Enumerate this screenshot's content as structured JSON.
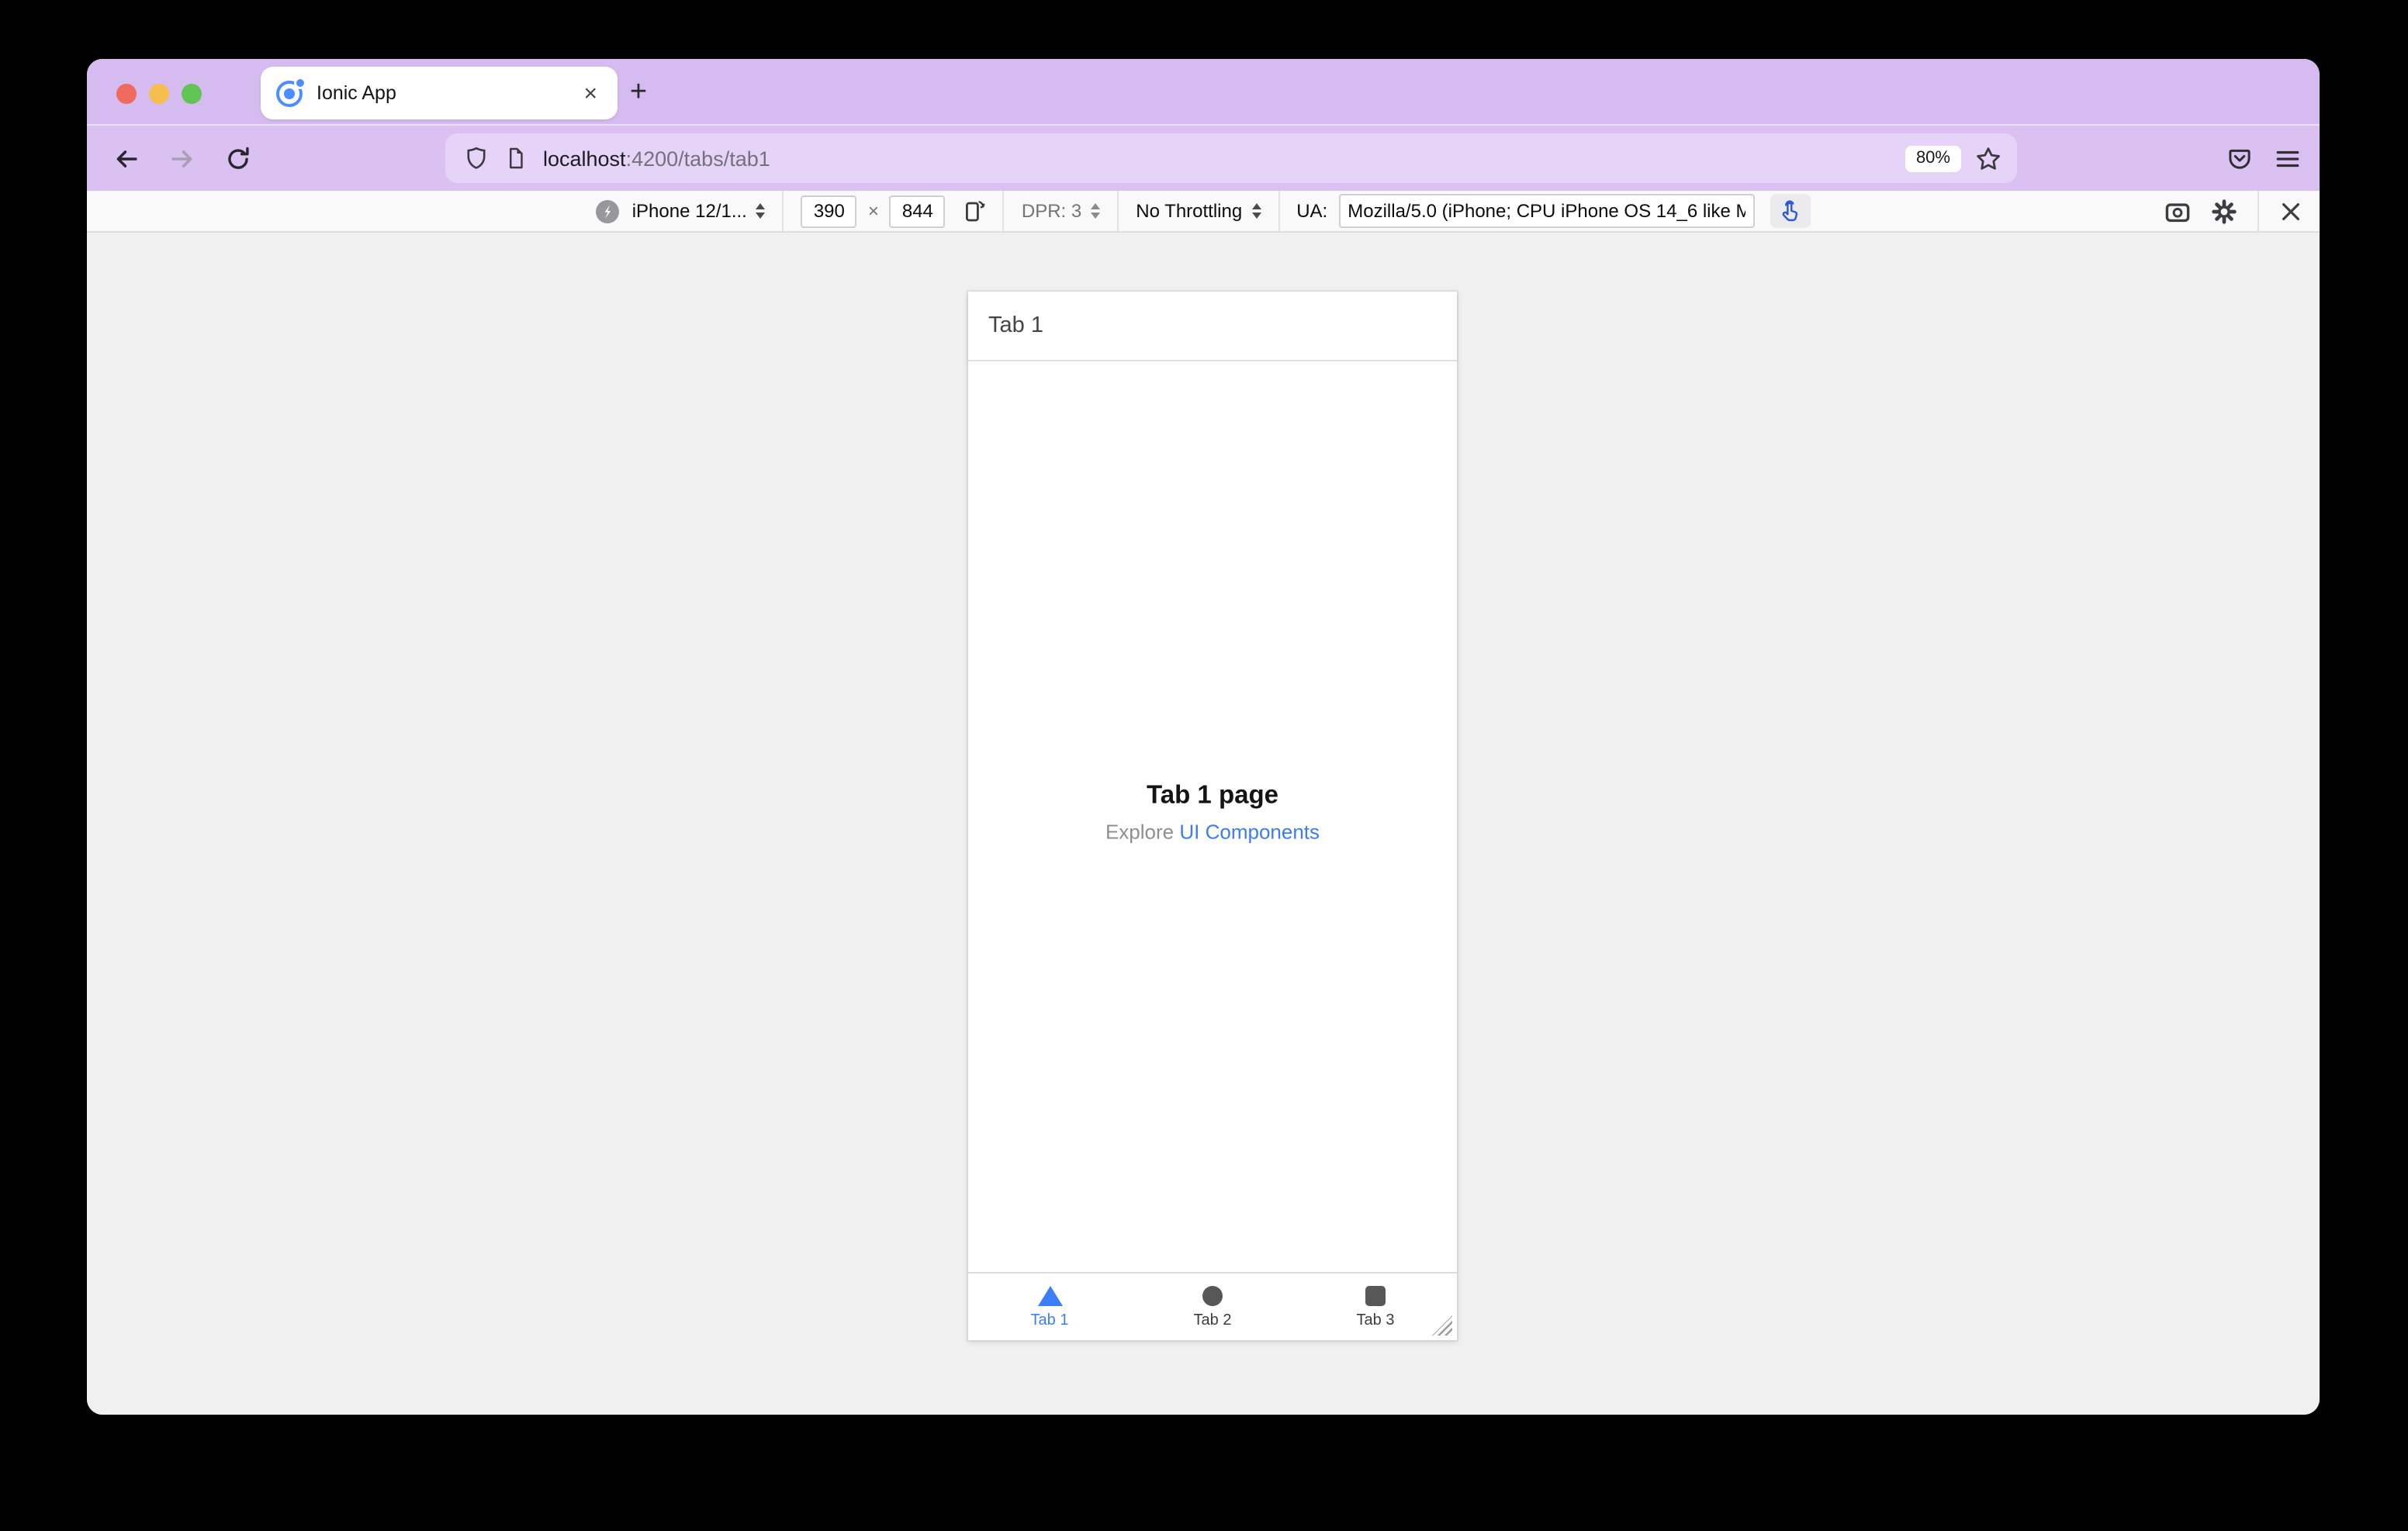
{
  "window": {
    "tab_title": "Ionic App",
    "tab_close": "×",
    "new_tab": "+"
  },
  "navbar": {
    "url_host": "localhost",
    "url_path": ":4200/tabs/tab1",
    "zoom_level": "80%"
  },
  "rdm_toolbar": {
    "device_selected": "iPhone 12/1...",
    "width_value": "390",
    "times": "×",
    "height_value": "844",
    "dpr": "DPR: 3",
    "throttling_selected": "No Throttling",
    "ua_label": "UA:",
    "ua_value": "Mozilla/5.0 (iPhone; CPU iPhone OS 14_6 like M"
  },
  "phone": {
    "header_title": "Tab 1",
    "page_title": "Tab 1 page",
    "explore_prefix": "Explore ",
    "explore_link": "UI Components",
    "tabs": [
      {
        "label": "Tab 1",
        "icon": "triangle-icon",
        "active": true
      },
      {
        "label": "Tab 2",
        "icon": "circle-icon",
        "active": false
      },
      {
        "label": "Tab 3",
        "icon": "square-icon",
        "active": false
      }
    ]
  },
  "colors": {
    "titlebar_purple": "#d6bbf0",
    "navbar_purple": "#dbc1f2",
    "urlfield_purple": "#e6d3f8",
    "toolbar_bg": "#f9f9fa",
    "content_bg": "#f0f0f1",
    "ionic_primary_blue": "#3c7ef6",
    "link_blue": "#3d7cf3",
    "touch_icon_blue": "#2b59d8",
    "traffic_red": "#ee6a5f",
    "traffic_yellow": "#f5bf4f",
    "traffic_green": "#61c454"
  }
}
